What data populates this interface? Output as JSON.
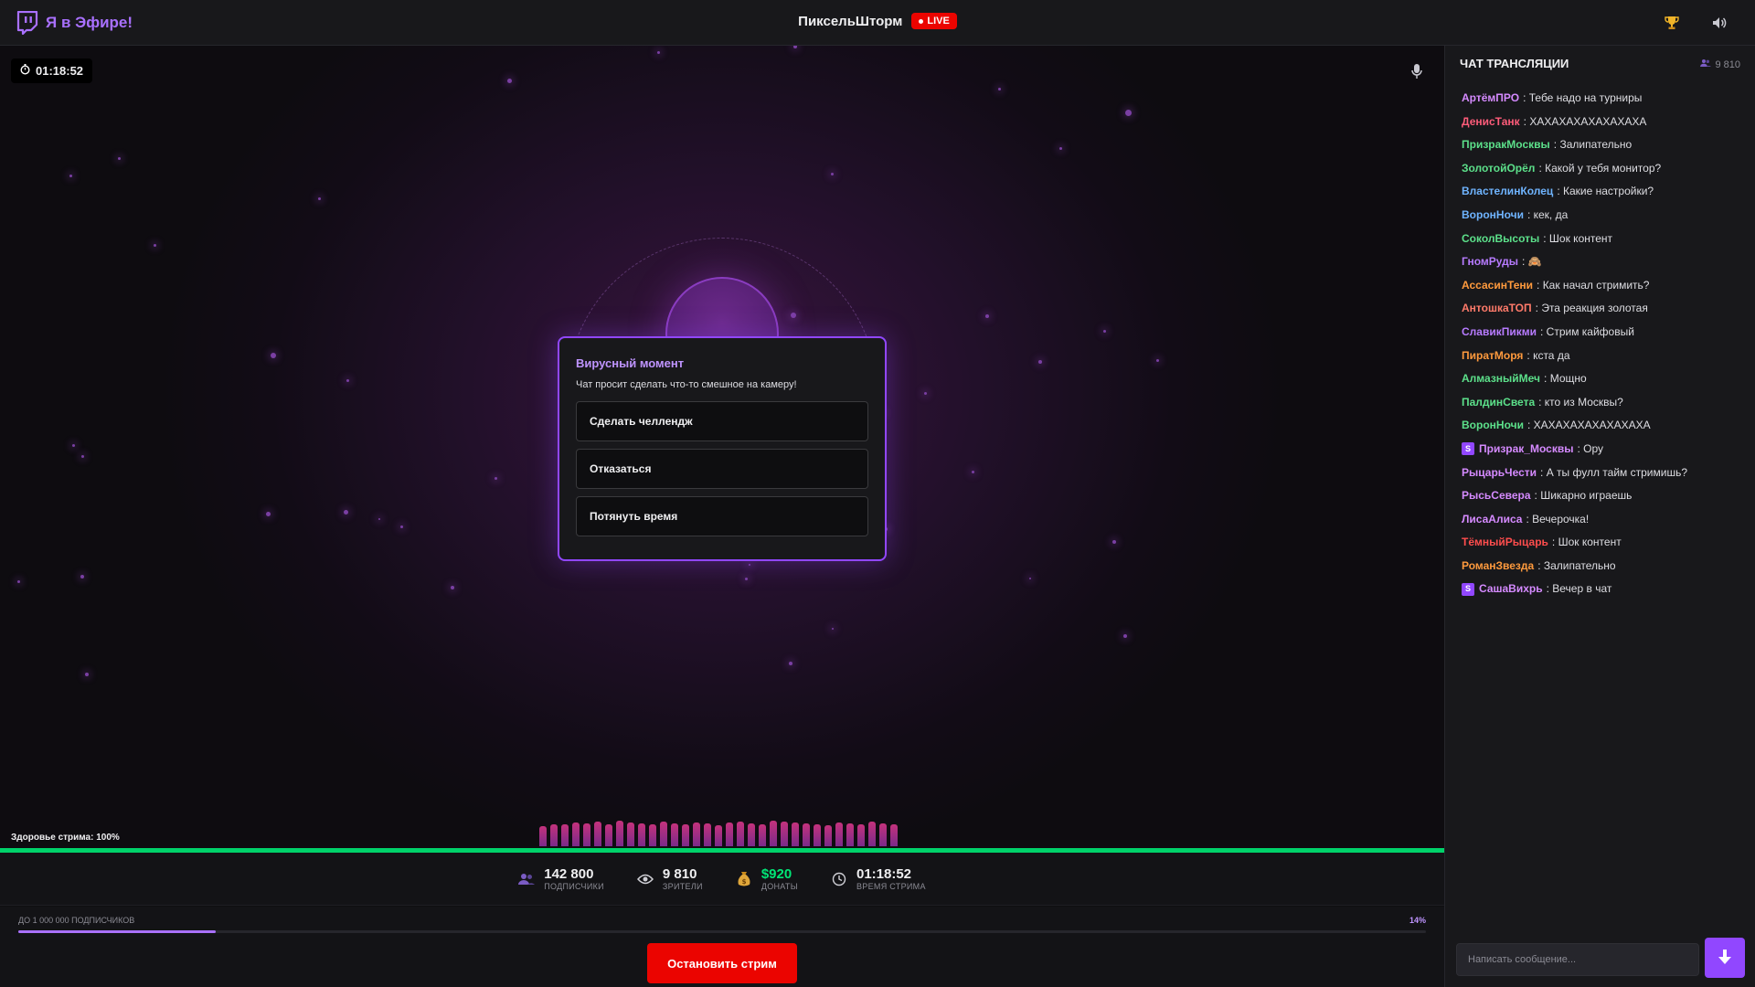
{
  "app": {
    "logo_text": "Я в Эфире!",
    "logo_icon": "twitch-logo-icon",
    "streamer_name": "ПиксельШторм",
    "live_label": "LIVE",
    "trophy_icon": "trophy-icon",
    "sound_icon": "speaker-icon"
  },
  "stage": {
    "timer": "01:18:52",
    "timer_icon": "stopwatch-icon",
    "mic_icon": "microphone-icon",
    "health_label": "Здоровье стрима: 100%",
    "health_percent": 100
  },
  "event_dialog": {
    "title": "Вирусный момент",
    "text": "Чат просит сделать что-то смешное на камеру!",
    "choices": [
      {
        "label": "Сделать челлендж"
      },
      {
        "label": "Отказаться"
      },
      {
        "label": "Потянуть время"
      }
    ]
  },
  "stats": [
    {
      "icon": "users-icon",
      "value": "142 800",
      "label": "ПОДПИСЧИКИ",
      "accent": "#efeff1"
    },
    {
      "icon": "eye-icon",
      "value": "9 810",
      "label": "ЗРИТЕЛИ",
      "accent": "#efeff1"
    },
    {
      "icon": "money-bag-icon",
      "value": "$920",
      "label": "ДОНАТЫ",
      "accent": "#00e676"
    },
    {
      "icon": "clock-icon",
      "value": "01:18:52",
      "label": "ВРЕМЯ СТРИМА",
      "accent": "#efeff1"
    }
  ],
  "goal": {
    "label": "ДО 1 000 000 ПОДПИСЧИКОВ",
    "percent_text": "14%",
    "progress": 0.14
  },
  "footer": {
    "stop_button": "Остановить стрим"
  },
  "chat": {
    "header": "ЧАТ ТРАНСЛЯЦИИ",
    "viewer_count": "9 810",
    "input_placeholder": "Написать сообщение...",
    "send_icon": "arrow-down-icon",
    "messages": [
      {
        "user": "АртёмПРО",
        "text": "Тебе надо на турниры",
        "color": "#d58aff",
        "badge": ""
      },
      {
        "user": "ДенисТанк",
        "text": "ХАХАХАХАХАХАХАХА",
        "color": "#ff5c7a",
        "badge": ""
      },
      {
        "user": "ПризракМосквы",
        "text": "Залипательно",
        "color": "#5ce08a",
        "badge": ""
      },
      {
        "user": "ЗолотойОрёл",
        "text": "Какой у тебя монитор?",
        "color": "#5ce08a",
        "badge": ""
      },
      {
        "user": "ВластелинКолец",
        "text": "Какие настройки?",
        "color": "#6fb4ff",
        "badge": ""
      },
      {
        "user": "ВоронНочи",
        "text": "кек, да",
        "color": "#6fb4ff",
        "badge": ""
      },
      {
        "user": "СоколВысоты",
        "text": "Шок контент",
        "color": "#5ce08a",
        "badge": ""
      },
      {
        "user": "ГномРуды",
        "text": "🙈",
        "color": "#b77bff",
        "badge": ""
      },
      {
        "user": "АссасинТени",
        "text": "Как начал стримить?",
        "color": "#ff9a3d",
        "badge": ""
      },
      {
        "user": "АнтошкаТОП",
        "text": "Эта реакция золотая",
        "color": "#ff7a6a",
        "badge": ""
      },
      {
        "user": "СлавикПикми",
        "text": "Стрим кайфовый",
        "color": "#b77bff",
        "badge": ""
      },
      {
        "user": "ПиратМоря",
        "text": "кста да",
        "color": "#ff9a3d",
        "badge": ""
      },
      {
        "user": "АлмазныйМеч",
        "text": "Мощно",
        "color": "#5ce08a",
        "badge": ""
      },
      {
        "user": "ПалдинСвета",
        "text": "кто из Москвы?",
        "color": "#5ce08a",
        "badge": ""
      },
      {
        "user": "ВоронНочи",
        "text": "ХАХАХАХАХАХАХАХА",
        "color": "#5ce08a",
        "badge": ""
      },
      {
        "user": "Призрак_Москвы",
        "text": "Ору",
        "color": "#d58aff",
        "badge": "S"
      },
      {
        "user": "РыцарьЧести",
        "text": "А ты фулл тайм стримишь?",
        "color": "#d58aff",
        "badge": ""
      },
      {
        "user": "РысьСевера",
        "text": "Шикарно играешь",
        "color": "#d58aff",
        "badge": ""
      },
      {
        "user": "ЛисаАлиса",
        "text": "Вечерочка!",
        "color": "#d58aff",
        "badge": ""
      },
      {
        "user": "ТёмныйРыцарь",
        "text": "Шок контент",
        "color": "#ff4d4d",
        "badge": ""
      },
      {
        "user": "РоманЗвезда",
        "text": "Залипательно",
        "color": "#ff9a3d",
        "badge": ""
      },
      {
        "user": "СашаВихрь",
        "text": "Вечер в чат",
        "color": "#d58aff",
        "badge": "S"
      }
    ]
  }
}
